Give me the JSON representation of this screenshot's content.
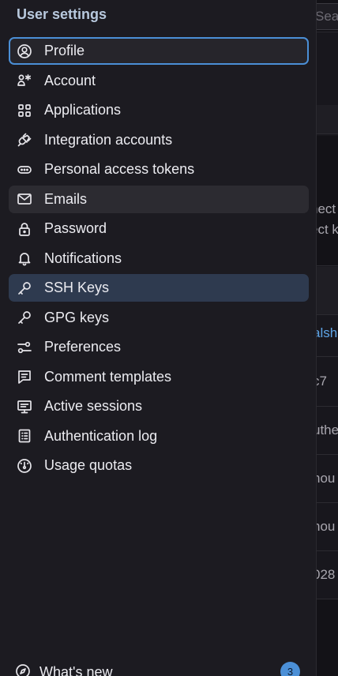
{
  "background": {
    "search_placeholder": "Sea",
    "fragments": [
      {
        "text": "nect",
        "link": false
      },
      {
        "text": "ect k",
        "link": false
      },
      {
        "text": "alsh",
        "link": true
      },
      {
        "text": "c7",
        "link": false
      },
      {
        "text": "uthe",
        "link": false
      },
      {
        "text": "hou",
        "link": false
      },
      {
        "text": "hou",
        "link": false
      },
      {
        "text": "028",
        "link": false
      }
    ]
  },
  "sidebar": {
    "title": "User settings",
    "items": [
      {
        "label": "Profile",
        "icon": "profile-icon",
        "state": "focused"
      },
      {
        "label": "Account",
        "icon": "account-icon",
        "state": ""
      },
      {
        "label": "Applications",
        "icon": "applications-icon",
        "state": ""
      },
      {
        "label": "Integration accounts",
        "icon": "plug-icon",
        "state": ""
      },
      {
        "label": "Personal access tokens",
        "icon": "token-icon",
        "state": ""
      },
      {
        "label": "Emails",
        "icon": "mail-icon",
        "state": "hover"
      },
      {
        "label": "Password",
        "icon": "lock-icon",
        "state": ""
      },
      {
        "label": "Notifications",
        "icon": "bell-icon",
        "state": ""
      },
      {
        "label": "SSH Keys",
        "icon": "key-icon",
        "state": "active"
      },
      {
        "label": "GPG keys",
        "icon": "key-icon",
        "state": ""
      },
      {
        "label": "Preferences",
        "icon": "preferences-icon",
        "state": ""
      },
      {
        "label": "Comment templates",
        "icon": "comment-icon",
        "state": ""
      },
      {
        "label": "Active sessions",
        "icon": "monitor-icon",
        "state": ""
      },
      {
        "label": "Authentication log",
        "icon": "log-icon",
        "state": ""
      },
      {
        "label": "Usage quotas",
        "icon": "gauge-icon",
        "state": ""
      }
    ],
    "footer": {
      "label": "What's new",
      "icon": "compass-icon",
      "badge": "3"
    }
  },
  "colors": {
    "accent": "#4b8fd6",
    "active_bg": "#2e3a4f",
    "sidebar_bg": "#1c1b21",
    "title": "#b8c9de"
  }
}
